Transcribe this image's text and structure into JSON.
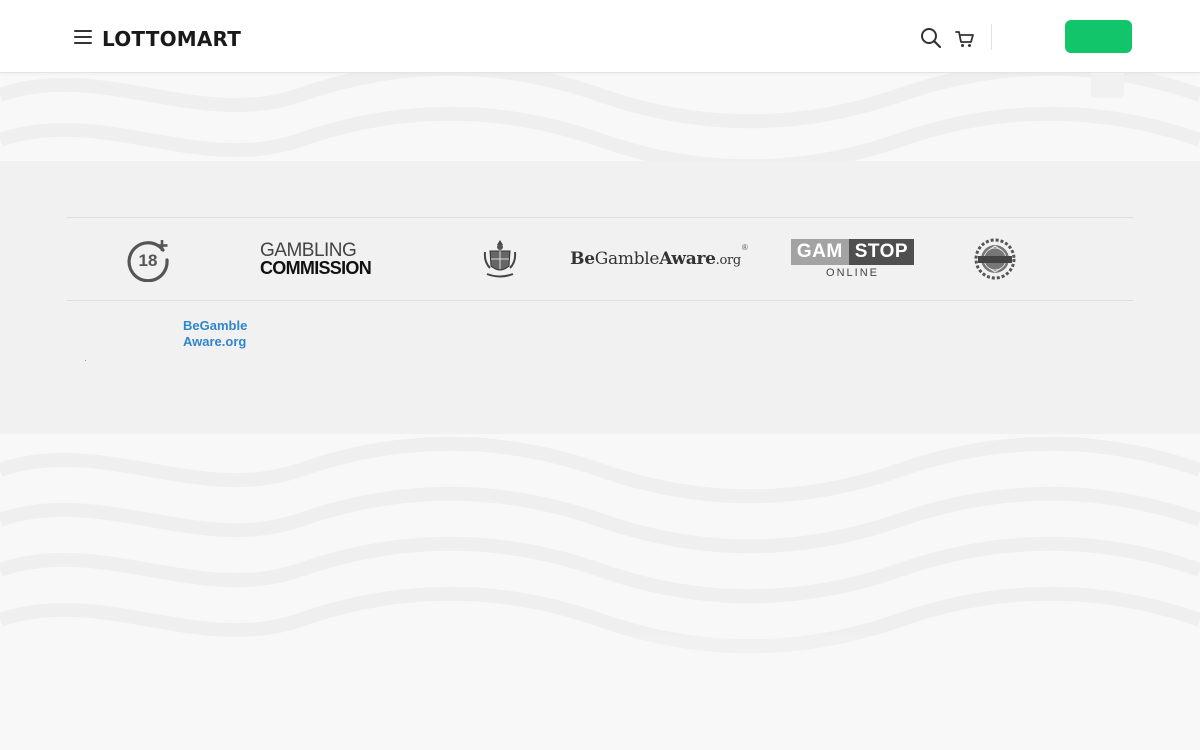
{
  "header": {
    "logo_text": "LOTTOMART",
    "cta_label": ""
  },
  "compliance_logos": {
    "age_label": "18",
    "gambling_commission_line1": "GAMBLING",
    "gambling_commission_line2": "COMMISSION",
    "begambleaware_be": "Be",
    "begambleaware_gamble": "Gamble",
    "begambleaware_aware": "Aware",
    "begambleaware_org": ".org",
    "begambleaware_reg": "®",
    "gamstop_gam": "GAM",
    "gamstop_stop": "STOP",
    "gamstop_online": "ONLINE"
  },
  "footer": {
    "begambleaware_link": "BeGamble Aware.org"
  },
  "colors": {
    "accent_green": "#12c56b",
    "link_blue": "#2f86cc",
    "footer_band": "#f1f1f1"
  },
  "icons": [
    "menu-icon",
    "search-icon",
    "cart-icon",
    "age-restriction-icon",
    "crest-icon",
    "verified-seal-icon"
  ]
}
